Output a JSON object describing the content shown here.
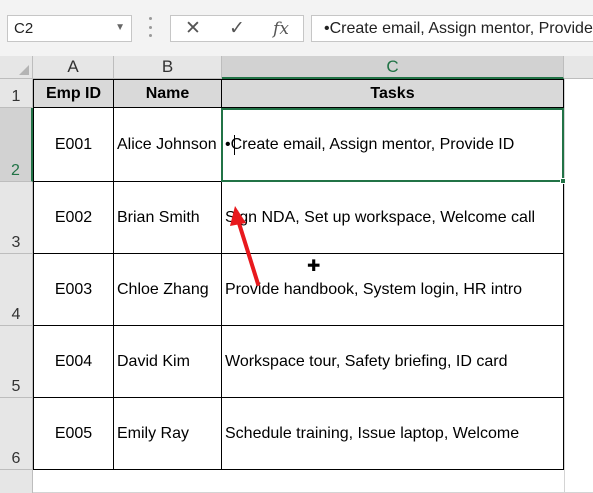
{
  "formula_bar": {
    "name_box": "C2",
    "cancel_icon": "✕",
    "enter_icon": "✓",
    "function_label": "fx",
    "formula": "•Create email, Assign mentor, Provide ID"
  },
  "columns": [
    "A",
    "B",
    "C"
  ],
  "rows": [
    "1",
    "2",
    "3",
    "4",
    "5",
    "6"
  ],
  "table": {
    "headers": [
      "Emp ID",
      "Name",
      "Tasks"
    ],
    "records": [
      {
        "id": "E001",
        "name": "Alice Johnson",
        "tasks": "•Create email, Assign mentor, Provide ID"
      },
      {
        "id": "E002",
        "name": "Brian Smith",
        "tasks": "Sign NDA, Set up workspace, Welcome call"
      },
      {
        "id": "E003",
        "name": "Chloe Zhang",
        "tasks": "Provide handbook, System login, HR intro"
      },
      {
        "id": "E004",
        "name": "David Kim",
        "tasks": "Workspace tour, Safety briefing, ID card"
      },
      {
        "id": "E005",
        "name": "Emily Ray",
        "tasks": "Schedule training, Issue laptop, Welcome"
      }
    ]
  },
  "selection": {
    "active_column": "C",
    "active_row": "2"
  },
  "colors": {
    "accent": "#217346",
    "header_fill": "#d9d9d9",
    "arrow": "#e8191d"
  },
  "icons": {
    "name_box_dropdown": "chevron-down-icon",
    "cursor": "plus-cursor-icon",
    "annotation": "red-arrow-icon"
  }
}
